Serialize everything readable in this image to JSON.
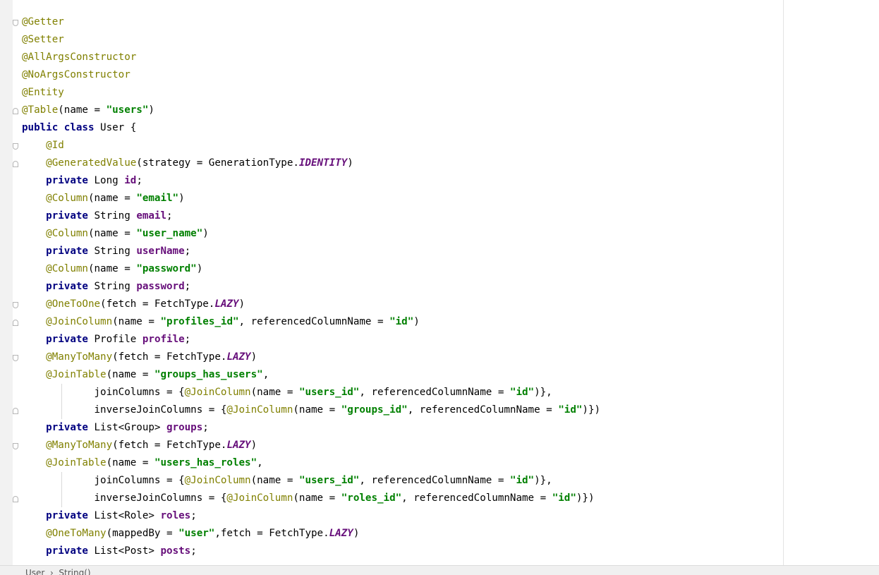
{
  "editor": {
    "lines": [
      {
        "fold": "start",
        "tokens": [
          {
            "t": "@Getter",
            "c": "ann"
          }
        ]
      },
      {
        "tokens": [
          {
            "t": "@Setter",
            "c": "ann"
          }
        ]
      },
      {
        "tokens": [
          {
            "t": "@AllArgsConstructor",
            "c": "ann"
          }
        ]
      },
      {
        "tokens": [
          {
            "t": "@NoArgsConstructor",
            "c": "ann"
          }
        ]
      },
      {
        "tokens": [
          {
            "t": "@Entity",
            "c": "ann"
          }
        ]
      },
      {
        "fold": "end",
        "tokens": [
          {
            "t": "@Table",
            "c": "ann"
          },
          {
            "t": "(name = ",
            "c": "plain"
          },
          {
            "t": "\"users\"",
            "c": "str"
          },
          {
            "t": ")",
            "c": "plain"
          }
        ]
      },
      {
        "tokens": [
          {
            "t": "public class ",
            "c": "kw"
          },
          {
            "t": "User {",
            "c": "plain"
          }
        ]
      },
      {
        "fold": "start",
        "tokens": [
          {
            "t": "    ",
            "c": "plain"
          },
          {
            "t": "@Id",
            "c": "ann"
          }
        ]
      },
      {
        "fold": "end",
        "tokens": [
          {
            "t": "    ",
            "c": "plain"
          },
          {
            "t": "@GeneratedValue",
            "c": "ann"
          },
          {
            "t": "(strategy = GenerationType.",
            "c": "plain"
          },
          {
            "t": "IDENTITY",
            "c": "const"
          },
          {
            "t": ")",
            "c": "plain"
          }
        ]
      },
      {
        "tokens": [
          {
            "t": "    ",
            "c": "plain"
          },
          {
            "t": "private ",
            "c": "kw"
          },
          {
            "t": "Long ",
            "c": "plain"
          },
          {
            "t": "id",
            "c": "fld"
          },
          {
            "t": ";",
            "c": "plain"
          }
        ]
      },
      {
        "tokens": [
          {
            "t": "    ",
            "c": "plain"
          },
          {
            "t": "@Column",
            "c": "ann"
          },
          {
            "t": "(name = ",
            "c": "plain"
          },
          {
            "t": "\"email\"",
            "c": "str"
          },
          {
            "t": ")",
            "c": "plain"
          }
        ]
      },
      {
        "tokens": [
          {
            "t": "    ",
            "c": "plain"
          },
          {
            "t": "private ",
            "c": "kw"
          },
          {
            "t": "String ",
            "c": "plain"
          },
          {
            "t": "email",
            "c": "fld"
          },
          {
            "t": ";",
            "c": "plain"
          }
        ]
      },
      {
        "tokens": [
          {
            "t": "    ",
            "c": "plain"
          },
          {
            "t": "@Column",
            "c": "ann"
          },
          {
            "t": "(name = ",
            "c": "plain"
          },
          {
            "t": "\"user_name\"",
            "c": "str"
          },
          {
            "t": ")",
            "c": "plain"
          }
        ]
      },
      {
        "tokens": [
          {
            "t": "    ",
            "c": "plain"
          },
          {
            "t": "private ",
            "c": "kw"
          },
          {
            "t": "String ",
            "c": "plain"
          },
          {
            "t": "userName",
            "c": "fld"
          },
          {
            "t": ";",
            "c": "plain"
          }
        ]
      },
      {
        "tokens": [
          {
            "t": "    ",
            "c": "plain"
          },
          {
            "t": "@Column",
            "c": "ann"
          },
          {
            "t": "(name = ",
            "c": "plain"
          },
          {
            "t": "\"password\"",
            "c": "str"
          },
          {
            "t": ")",
            "c": "plain"
          }
        ]
      },
      {
        "tokens": [
          {
            "t": "    ",
            "c": "plain"
          },
          {
            "t": "private ",
            "c": "kw"
          },
          {
            "t": "String ",
            "c": "plain"
          },
          {
            "t": "password",
            "c": "fld"
          },
          {
            "t": ";",
            "c": "plain"
          }
        ]
      },
      {
        "fold": "start",
        "tokens": [
          {
            "t": "    ",
            "c": "plain"
          },
          {
            "t": "@OneToOne",
            "c": "ann"
          },
          {
            "t": "(fetch = FetchType.",
            "c": "plain"
          },
          {
            "t": "LAZY",
            "c": "const"
          },
          {
            "t": ")",
            "c": "plain"
          }
        ]
      },
      {
        "fold": "end",
        "tokens": [
          {
            "t": "    ",
            "c": "plain"
          },
          {
            "t": "@JoinColumn",
            "c": "ann"
          },
          {
            "t": "(name = ",
            "c": "plain"
          },
          {
            "t": "\"profiles_id\"",
            "c": "str"
          },
          {
            "t": ", referencedColumnName = ",
            "c": "plain"
          },
          {
            "t": "\"id\"",
            "c": "str"
          },
          {
            "t": ")",
            "c": "plain"
          }
        ]
      },
      {
        "tokens": [
          {
            "t": "    ",
            "c": "plain"
          },
          {
            "t": "private ",
            "c": "kw"
          },
          {
            "t": "Profile ",
            "c": "plain"
          },
          {
            "t": "profile",
            "c": "fld"
          },
          {
            "t": ";",
            "c": "plain"
          }
        ]
      },
      {
        "fold": "start",
        "tokens": [
          {
            "t": "    ",
            "c": "plain"
          },
          {
            "t": "@ManyToMany",
            "c": "ann"
          },
          {
            "t": "(fetch = FetchType.",
            "c": "plain"
          },
          {
            "t": "LAZY",
            "c": "const"
          },
          {
            "t": ")",
            "c": "plain"
          }
        ]
      },
      {
        "tokens": [
          {
            "t": "    ",
            "c": "plain"
          },
          {
            "t": "@JoinTable",
            "c": "ann"
          },
          {
            "t": "(name = ",
            "c": "plain"
          },
          {
            "t": "\"groups_has_users\"",
            "c": "str"
          },
          {
            "t": ",",
            "c": "plain"
          }
        ]
      },
      {
        "tokens": [
          {
            "t": "            joinColumns = {",
            "c": "plain"
          },
          {
            "t": "@JoinColumn",
            "c": "ann"
          },
          {
            "t": "(name = ",
            "c": "plain"
          },
          {
            "t": "\"users_id\"",
            "c": "str"
          },
          {
            "t": ", referencedColumnName = ",
            "c": "plain"
          },
          {
            "t": "\"id\"",
            "c": "str"
          },
          {
            "t": ")},",
            "c": "plain"
          }
        ]
      },
      {
        "fold": "end",
        "tokens": [
          {
            "t": "            inverseJoinColumns = {",
            "c": "plain"
          },
          {
            "t": "@JoinColumn",
            "c": "ann"
          },
          {
            "t": "(name = ",
            "c": "plain"
          },
          {
            "t": "\"groups_id\"",
            "c": "str"
          },
          {
            "t": ", referencedColumnName = ",
            "c": "plain"
          },
          {
            "t": "\"id\"",
            "c": "str"
          },
          {
            "t": ")})",
            "c": "plain"
          }
        ]
      },
      {
        "tokens": [
          {
            "t": "    ",
            "c": "plain"
          },
          {
            "t": "private ",
            "c": "kw"
          },
          {
            "t": "List<Group> ",
            "c": "plain"
          },
          {
            "t": "groups",
            "c": "fld"
          },
          {
            "t": ";",
            "c": "plain"
          }
        ]
      },
      {
        "fold": "start",
        "tokens": [
          {
            "t": "    ",
            "c": "plain"
          },
          {
            "t": "@ManyToMany",
            "c": "ann"
          },
          {
            "t": "(fetch = FetchType.",
            "c": "plain"
          },
          {
            "t": "LAZY",
            "c": "const"
          },
          {
            "t": ")",
            "c": "plain"
          }
        ]
      },
      {
        "tokens": [
          {
            "t": "    ",
            "c": "plain"
          },
          {
            "t": "@JoinTable",
            "c": "ann"
          },
          {
            "t": "(name = ",
            "c": "plain"
          },
          {
            "t": "\"users_has_roles\"",
            "c": "str"
          },
          {
            "t": ",",
            "c": "plain"
          }
        ]
      },
      {
        "tokens": [
          {
            "t": "            joinColumns = {",
            "c": "plain"
          },
          {
            "t": "@JoinColumn",
            "c": "ann"
          },
          {
            "t": "(name = ",
            "c": "plain"
          },
          {
            "t": "\"users_id\"",
            "c": "str"
          },
          {
            "t": ", referencedColumnName = ",
            "c": "plain"
          },
          {
            "t": "\"id\"",
            "c": "str"
          },
          {
            "t": ")},",
            "c": "plain"
          }
        ]
      },
      {
        "fold": "end",
        "tokens": [
          {
            "t": "            inverseJoinColumns = {",
            "c": "plain"
          },
          {
            "t": "@JoinColumn",
            "c": "ann"
          },
          {
            "t": "(name = ",
            "c": "plain"
          },
          {
            "t": "\"roles_id\"",
            "c": "str"
          },
          {
            "t": ", referencedColumnName = ",
            "c": "plain"
          },
          {
            "t": "\"id\"",
            "c": "str"
          },
          {
            "t": ")})",
            "c": "plain"
          }
        ]
      },
      {
        "tokens": [
          {
            "t": "    ",
            "c": "plain"
          },
          {
            "t": "private ",
            "c": "kw"
          },
          {
            "t": "List<Role> ",
            "c": "plain"
          },
          {
            "t": "roles",
            "c": "fld"
          },
          {
            "t": ";",
            "c": "plain"
          }
        ]
      },
      {
        "tokens": [
          {
            "t": "    ",
            "c": "plain"
          },
          {
            "t": "@OneToMany",
            "c": "ann"
          },
          {
            "t": "(mappedBy = ",
            "c": "plain"
          },
          {
            "t": "\"user\"",
            "c": "str"
          },
          {
            "t": ",fetch = FetchType.",
            "c": "plain"
          },
          {
            "t": "LAZY",
            "c": "const"
          },
          {
            "t": ")",
            "c": "plain"
          }
        ]
      },
      {
        "tokens": [
          {
            "t": "    ",
            "c": "plain"
          },
          {
            "t": "private ",
            "c": "kw"
          },
          {
            "t": "List<Post> ",
            "c": "plain"
          },
          {
            "t": "posts",
            "c": "fld"
          },
          {
            "t": ";",
            "c": "plain"
          }
        ]
      }
    ]
  },
  "statusbar": {
    "breadcrumb": "User  ›  String()"
  },
  "colors": {
    "annotation": "#808000",
    "keyword": "#000080",
    "string": "#008000",
    "field": "#660e7a"
  }
}
